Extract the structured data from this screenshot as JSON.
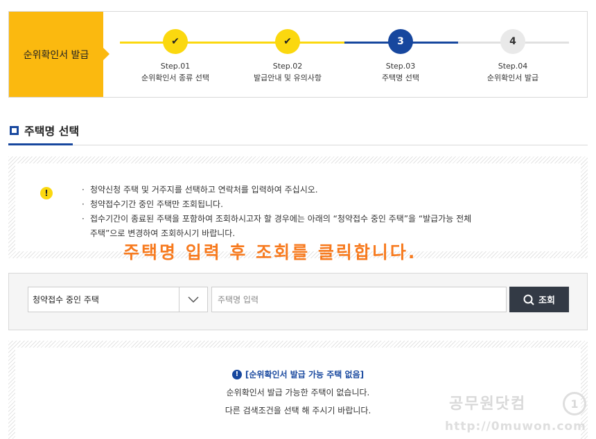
{
  "stepbar": {
    "label": "순위확인서 발급",
    "steps": [
      {
        "title": "Step.01",
        "desc": "순위확인서 종류 선택",
        "state": "done",
        "mark": "✔"
      },
      {
        "title": "Step.02",
        "desc": "발급안내 및 유의사항",
        "state": "done",
        "mark": "✔"
      },
      {
        "title": "Step.03",
        "desc": "주택명 선택",
        "state": "current",
        "mark": "3"
      },
      {
        "title": "Step.04",
        "desc": "순위확인서 발급",
        "state": "todo",
        "mark": "4"
      }
    ]
  },
  "section": {
    "title": "주택명 선택"
  },
  "notice": {
    "icon": "exclamation-icon",
    "items": [
      "청약신청 주택 및 거주지를 선택하고 연락처를 입력하여 주십시오.",
      "청약접수기간 중인 주택만 조회됩니다.",
      "접수기간이 종료된 주택을 포함하여 조회하시고자 할 경우에는 아래의 “청약접수 중인 주택”을 “발급가능 전체",
      "주택”으로 변경하여 조회하시기 바랍니다."
    ]
  },
  "overlay_caption": "주택명 입력 후 조회를 클릭합니다.",
  "search": {
    "select_value": "청약접수 중인 주택",
    "input_placeholder": "주택명 입력",
    "button_label": "조회"
  },
  "result": {
    "title": "[순위확인서 발급 가능 주택 없음]",
    "line1": "순위확인서 발급 가능한 주택이 없습니다.",
    "line2": "다른 검색조건을 선택 해 주시기 바랍니다."
  },
  "watermark": {
    "text": "공무원닷컴",
    "url": "http://0muwon.com"
  },
  "colors": {
    "accent_yellow": "#fbb90f",
    "step_done": "#fbd80f",
    "primary_blue": "#17479e",
    "button_dark": "#333a45",
    "caption_orange": "#f77a1e"
  }
}
